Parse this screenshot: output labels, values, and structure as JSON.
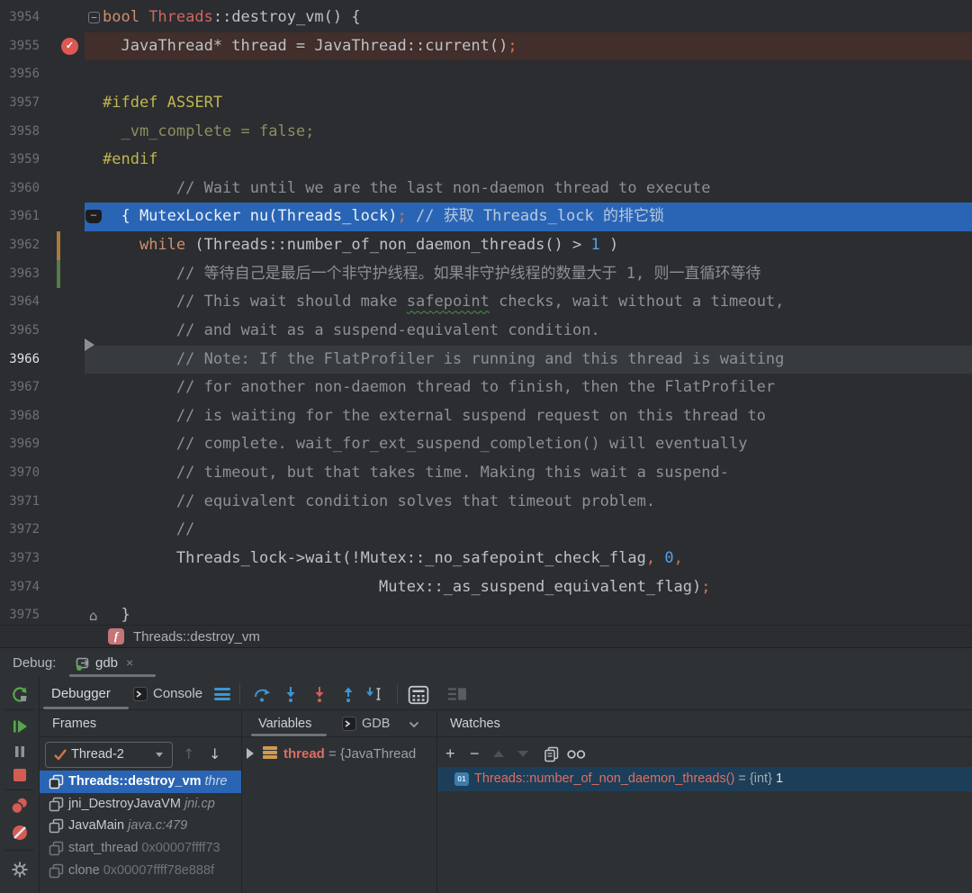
{
  "colors": {
    "editor_bg": "#2b2d30",
    "panel_bg": "#2e3134",
    "toolbar_bg": "#2f3234",
    "exec_line_blue": "#2a65b5",
    "breakpoint_line_red": "#422e2a",
    "caret_line": "#383b3e",
    "breakpoint_red": "#db5855",
    "keyword_orange": "#cf8e6d",
    "preprocessor_yellow": "#c0b64e",
    "comment_gray": "#8b9196",
    "number_blue": "#54a1e8",
    "selection_blue": "#2a65b5",
    "watch_row_bg": "#1d3e58",
    "vcs_orange": "#a87b3c",
    "vcs_green": "#537c48",
    "run_green": "#57a64e",
    "stop_red": "#d55b55",
    "step_blue": "#3f95d2"
  },
  "editor": {
    "lines": [
      {
        "num": "3954",
        "gutter": [
          "fold-minus"
        ],
        "seg": [
          {
            "t": "bool ",
            "c": "k"
          },
          {
            "t": "Threads",
            "c": "cls"
          },
          {
            "t": "::destroy_vm() {",
            "c": "txt"
          }
        ]
      },
      {
        "num": "3955",
        "bg": "breakpoint-line",
        "gutter": [
          "breakpoint"
        ],
        "seg": [
          {
            "t": "  JavaThread* thread = JavaThread::current()",
            "c": "txt"
          },
          {
            "t": ";",
            "c": "punc"
          }
        ]
      },
      {
        "num": "3956",
        "seg": []
      },
      {
        "num": "3957",
        "seg": [
          {
            "t": "#ifdef ASSERT",
            "c": "pp"
          }
        ]
      },
      {
        "num": "3958",
        "seg": [
          {
            "t": "  _vm_complete = false;",
            "c": "olive"
          }
        ]
      },
      {
        "num": "3959",
        "seg": [
          {
            "t": "#endif",
            "c": "pp"
          }
        ]
      },
      {
        "num": "3960",
        "seg": [
          {
            "t": "        // Wait until we are the last non-daemon thread to execute",
            "c": "cmt"
          }
        ]
      },
      {
        "num": "3961",
        "bg": "exec-line",
        "gutter": [
          "fold-dark"
        ],
        "seg": [
          {
            "t": "  { MutexLocker nu(Threads_lock)",
            "c": "bcode"
          },
          {
            "t": ";",
            "c": "punc"
          },
          {
            "t": " // 获取 Threads_lock 的排它锁",
            "c": "bcmt"
          }
        ]
      },
      {
        "num": "3962",
        "gutter": [
          "vcs-orange"
        ],
        "seg": [
          {
            "t": "    ",
            "c": "txt"
          },
          {
            "t": "while",
            "c": "k"
          },
          {
            "t": " (Threads::number_of_non_daemon_threads() > ",
            "c": "txt"
          },
          {
            "t": "1",
            "c": "num"
          },
          {
            "t": " )",
            "c": "txt"
          }
        ]
      },
      {
        "num": "3963",
        "gutter": [
          "vcs-green"
        ],
        "seg": [
          {
            "t": "        // 等待自己是最后一个非守护线程。如果非守护线程的数量大于 1, 则一直循环等待",
            "c": "cmt"
          }
        ]
      },
      {
        "num": "3964",
        "seg": [
          {
            "t": "        // This wait should make ",
            "c": "cmt"
          },
          {
            "t": "safepoint",
            "c": "cmt wavy"
          },
          {
            "t": " checks, wait without a timeout,",
            "c": "cmt"
          }
        ]
      },
      {
        "num": "3965",
        "seg": [
          {
            "t": "        // and wait as a suspend-equivalent condition.",
            "c": "cmt"
          }
        ]
      },
      {
        "num": "3966",
        "bg": "caret-line",
        "active": true,
        "gutter": [
          "exec-arrow"
        ],
        "seg": [
          {
            "t": "        // Note: If the FlatProfiler is running and this thread is waiting",
            "c": "cmt"
          }
        ]
      },
      {
        "num": "3967",
        "seg": [
          {
            "t": "        // for another non-daemon thread to finish, then the FlatProfiler",
            "c": "cmt"
          }
        ]
      },
      {
        "num": "3968",
        "seg": [
          {
            "t": "        // is waiting for the external suspend request on this thread to",
            "c": "cmt"
          }
        ]
      },
      {
        "num": "3969",
        "seg": [
          {
            "t": "        // complete. wait_for_ext_suspend_completion() will eventually",
            "c": "cmt"
          }
        ]
      },
      {
        "num": "3970",
        "seg": [
          {
            "t": "        // timeout, but that takes time. Making this wait a suspend-",
            "c": "cmt"
          }
        ]
      },
      {
        "num": "3971",
        "seg": [
          {
            "t": "        // equivalent condition solves that timeout problem.",
            "c": "cmt"
          }
        ]
      },
      {
        "num": "3972",
        "seg": [
          {
            "t": "        //",
            "c": "cmt"
          }
        ]
      },
      {
        "num": "3973",
        "seg": [
          {
            "t": "        Threads_lock->wait(!Mutex::_no_safepoint_check_flag",
            "c": "txt"
          },
          {
            "t": ",",
            "c": "punc"
          },
          {
            "t": " ",
            "c": "txt"
          },
          {
            "t": "0",
            "c": "num"
          },
          {
            "t": ",",
            "c": "punc"
          }
        ]
      },
      {
        "num": "3974",
        "seg": [
          {
            "t": "                              Mutex::_as_suspend_equivalent_flag)",
            "c": "txt"
          },
          {
            "t": ";",
            "c": "punc"
          }
        ]
      },
      {
        "num": "3975",
        "gutter": [
          "home"
        ],
        "seg": [
          {
            "t": "  }",
            "c": "txt"
          }
        ]
      }
    ]
  },
  "breadcrumb": {
    "icon_label": "f",
    "label": "Threads::destroy_vm"
  },
  "debug_bar": {
    "label": "Debug:",
    "tab_label": "gdb",
    "close_label": "×",
    "tab_icon": "run-config-icon"
  },
  "toolbar": {
    "debugger_tab": "Debugger",
    "console_tab": "Console",
    "icons": [
      "rerun-debug",
      "view-options",
      "step-over",
      "step-into",
      "force-step-into",
      "step-out",
      "run-to-cursor",
      "evaluate-expression",
      "layout-settings"
    ]
  },
  "left_toolbar": {
    "icons": [
      "rerun-debug",
      "resume-program",
      "pause-program",
      "stop-program",
      "view-breakpoints",
      "mute-breakpoints",
      "settings-gear"
    ]
  },
  "frames": {
    "title": "Frames",
    "thread_selector": "Thread-2",
    "toolbar_icons": [
      "thread-checkmark",
      "dropdown-caret",
      "move-up",
      "move-down"
    ],
    "up_glyph": "↑",
    "down_glyph": "↓",
    "rows": [
      {
        "name": "Threads::destroy_vm",
        "suffix": " thre",
        "italic": true,
        "selected": true
      },
      {
        "name": "jni_DestroyJavaVM",
        "suffix": " jni.cp",
        "italic": true
      },
      {
        "name": "JavaMain",
        "suffix": " java.c:479",
        "italic": true
      },
      {
        "name": "start_thread",
        "suffix": " 0x00007ffff73",
        "dim": true
      },
      {
        "name": "clone",
        "suffix": " 0x00007ffff78e888f",
        "dim": true
      }
    ]
  },
  "variables": {
    "tab_label": "Variables",
    "gdb_label": "GDB",
    "row": {
      "name": "thread",
      "eq": " = ",
      "value": "{JavaThread"
    }
  },
  "watches": {
    "title": "Watches",
    "toolbar": {
      "add": "+",
      "remove": "−",
      "icons": [
        "add-watch",
        "remove-watch",
        "move-up",
        "move-down",
        "duplicate-watch",
        "show-watches-glasses"
      ]
    },
    "row": {
      "icon_label": "01",
      "name": "Threads::number_of_non_daemon_threads()",
      "eq": " = ",
      "type": "{int}",
      "value": " 1"
    }
  }
}
